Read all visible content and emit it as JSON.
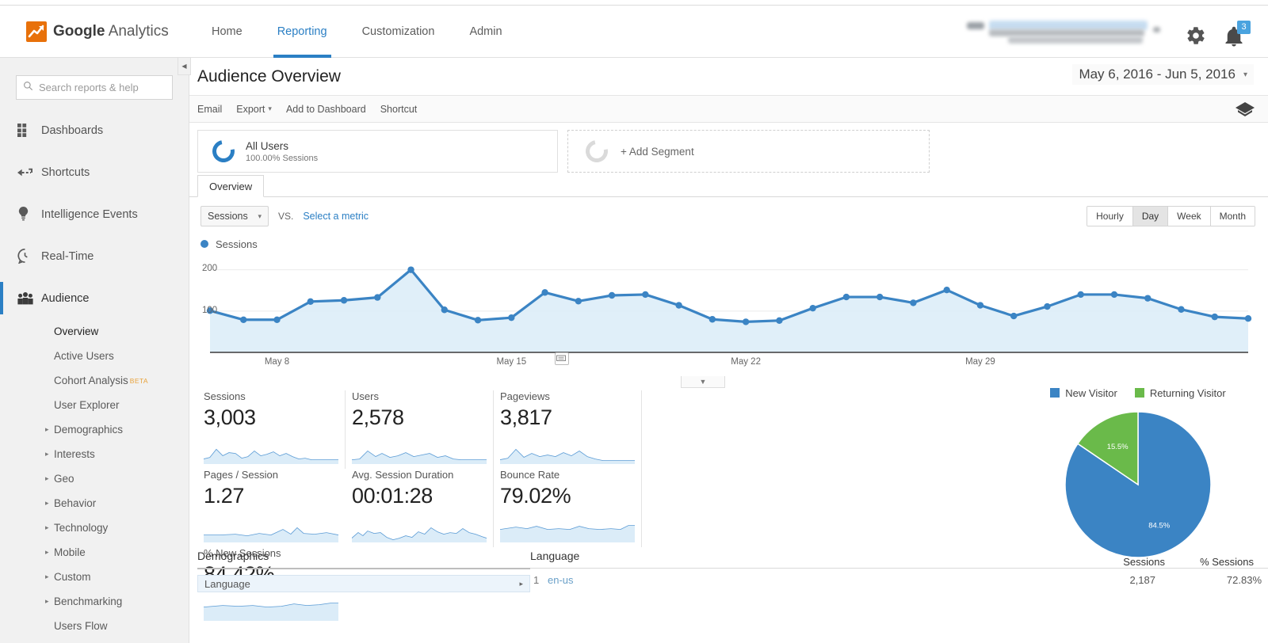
{
  "header": {
    "logo_text_bold": "Google",
    "logo_text_light": "Analytics",
    "logo_icon": "google-analytics-logo-icon",
    "nav": [
      {
        "label": "Home",
        "active": false
      },
      {
        "label": "Reporting",
        "active": true
      },
      {
        "label": "Customization",
        "active": false
      },
      {
        "label": "Admin",
        "active": false
      }
    ],
    "account_selector": "(redacted)",
    "gear_icon": "gear-icon",
    "bell_icon": "bell-icon",
    "notification_count": "3"
  },
  "sidebar": {
    "search_placeholder": "Search reports & help",
    "search_value": "",
    "search_icon": "search-icon",
    "items": [
      {
        "label": "Dashboards",
        "icon": "dashboards-grid-icon"
      },
      {
        "label": "Shortcuts",
        "icon": "shortcuts-arrow-icon"
      },
      {
        "label": "Intelligence Events",
        "icon": "lightbulb-icon"
      },
      {
        "label": "Real-Time",
        "icon": "clock-icon"
      },
      {
        "label": "Audience",
        "icon": "audience-people-icon"
      }
    ],
    "audience_sub": [
      {
        "label": "Overview",
        "expandable": false,
        "current": true
      },
      {
        "label": "Active Users",
        "expandable": false,
        "current": false
      },
      {
        "label": "Cohort Analysis",
        "expandable": false,
        "current": false,
        "badge": "BETA"
      },
      {
        "label": "User Explorer",
        "expandable": false,
        "current": false
      },
      {
        "label": "Demographics",
        "expandable": true,
        "current": false
      },
      {
        "label": "Interests",
        "expandable": true,
        "current": false
      },
      {
        "label": "Geo",
        "expandable": true,
        "current": false
      },
      {
        "label": "Behavior",
        "expandable": true,
        "current": false
      },
      {
        "label": "Technology",
        "expandable": true,
        "current": false
      },
      {
        "label": "Mobile",
        "expandable": true,
        "current": false
      },
      {
        "label": "Custom",
        "expandable": true,
        "current": false
      },
      {
        "label": "Benchmarking",
        "expandable": true,
        "current": false
      },
      {
        "label": "Users Flow",
        "expandable": false,
        "current": false
      }
    ],
    "collapse_icon": "collapse-sidebar-icon"
  },
  "main": {
    "page_title": "Audience Overview",
    "date_range": "May 6, 2016 - Jun 5, 2016",
    "date_range_caret": "▾",
    "toolbar": [
      {
        "label": "Email",
        "caret": ""
      },
      {
        "label": "Export",
        "caret": "▾"
      },
      {
        "label": "Add to Dashboard",
        "caret": ""
      },
      {
        "label": "Shortcut",
        "caret": ""
      }
    ],
    "share_icon": "share-icon",
    "segments": {
      "applied_name": "All Users",
      "applied_sub": "100.00% Sessions",
      "add_label": "+ Add Segment"
    },
    "tabs": [
      {
        "label": "Overview",
        "active": true
      }
    ],
    "metric_selector": {
      "value": "Sessions",
      "caret": "▾"
    },
    "vs_label": "VS.",
    "select_metric_link": "Select a metric",
    "granularity": [
      {
        "label": "Hourly",
        "selected": false
      },
      {
        "label": "Day",
        "selected": true
      },
      {
        "label": "Week",
        "selected": false
      },
      {
        "label": "Month",
        "selected": false
      }
    ],
    "legend_label": "Sessions",
    "chart_collapse_icon": "chevron-down-icon",
    "chart_annotation_icon": "annotation-icon"
  },
  "chart_data": {
    "type": "line",
    "title": "Sessions",
    "xlabel": "",
    "ylabel": "Sessions",
    "ylim": [
      0,
      230
    ],
    "yticks": [
      100,
      200
    ],
    "grid": true,
    "legend": [
      "Sessions"
    ],
    "legend_position": "top-left",
    "xticks": [
      "May 8",
      "May 15",
      "May 22",
      "May 29"
    ],
    "xtick_index": [
      2,
      9,
      16,
      23
    ],
    "x": [
      "May 6",
      "May 7",
      "May 8",
      "May 9",
      "May 10",
      "May 11",
      "May 12",
      "May 13",
      "May 14",
      "May 15",
      "May 16",
      "May 17",
      "May 18",
      "May 19",
      "May 20",
      "May 21",
      "May 22",
      "May 23",
      "May 24",
      "May 25",
      "May 26",
      "May 27",
      "May 28",
      "May 29",
      "May 30",
      "May 31",
      "Jun 1",
      "Jun 2",
      "Jun 3",
      "Jun 4",
      "Jun 5"
    ],
    "values": [
      101,
      79,
      79,
      123,
      126,
      133,
      200,
      103,
      78,
      84,
      145,
      124,
      138,
      140,
      114,
      80,
      74,
      77,
      107,
      134,
      134,
      120,
      151,
      114,
      88,
      111,
      140,
      140,
      131,
      104,
      86,
      82
    ]
  },
  "stats": {
    "cards": [
      {
        "label": "Sessions",
        "value": "3,003"
      },
      {
        "label": "Users",
        "value": "2,578"
      },
      {
        "label": "Pageviews",
        "value": "3,817"
      },
      {
        "label": "Pages / Session",
        "value": "1.27"
      },
      {
        "label": "Avg. Session Duration",
        "value": "00:01:28"
      },
      {
        "label": "Bounce Rate",
        "value": "79.02%"
      },
      {
        "label": "% New Sessions",
        "value": "84.42%"
      }
    ]
  },
  "visitor_pie": {
    "type": "pie",
    "title": "",
    "legend": [
      "New Visitor",
      "Returning Visitor"
    ],
    "categories": [
      "New Visitor",
      "Returning Visitor"
    ],
    "values": [
      84.5,
      15.5
    ],
    "labels": [
      "84.5%",
      "15.5%"
    ],
    "colors": [
      "#3b84c4",
      "#6aba4a"
    ],
    "legend_position": "top"
  },
  "bottom": {
    "demographics_title": "Demographics",
    "dimension_value": "Language",
    "dimension_caret": "▸",
    "language_title": "Language",
    "columns": [
      "Sessions",
      "% Sessions"
    ],
    "first_row": {
      "index": "1",
      "name": "en-us",
      "sessions": "2,187",
      "pct": "72.83%"
    }
  },
  "colors": {
    "brand_blue": "#2b7fc4",
    "line_blue": "#3b84c4",
    "area_fill": "#dbecf8",
    "green": "#6aba4a",
    "logo_orange": "#e8710a",
    "badge_blue": "#4aa3df"
  }
}
